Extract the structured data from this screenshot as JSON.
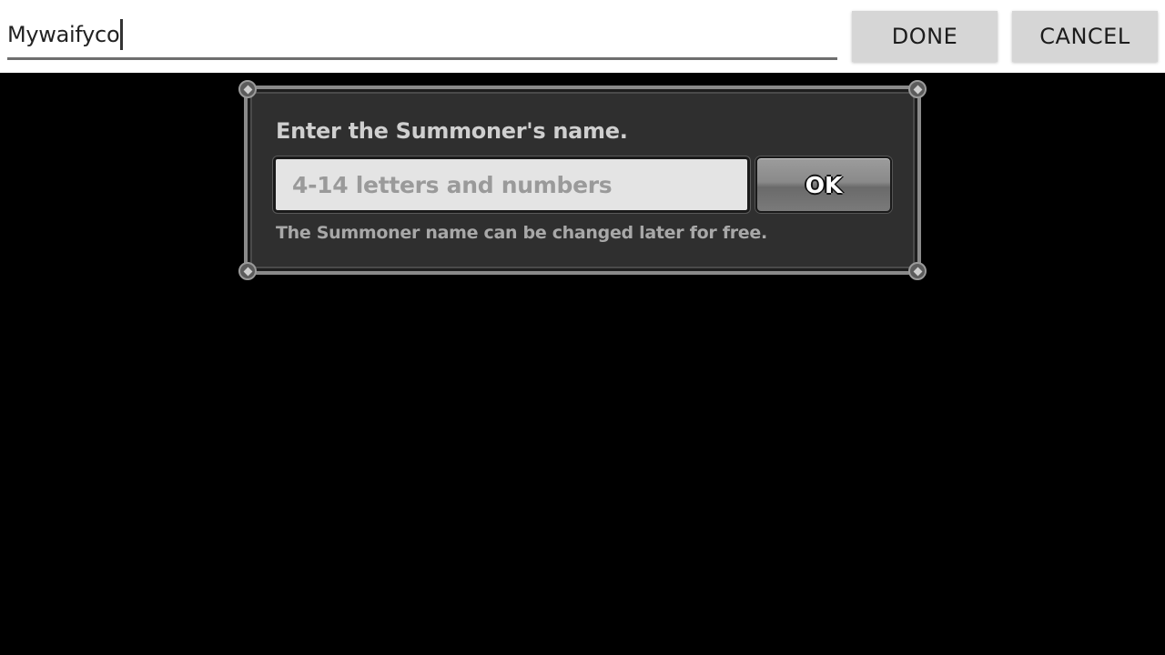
{
  "ime": {
    "input_value": "Mywaifyco",
    "done_label": "DONE",
    "cancel_label": "CANCEL"
  },
  "dialog": {
    "title": "Enter the Summoner's name.",
    "name_placeholder": "4-14 letters and numbers",
    "ok_label": "OK",
    "hint": "The Summoner name can be changed later for free."
  },
  "colors": {
    "background": "#000000",
    "ime_bar": "#ffffff",
    "ime_button": "#d6d6d6",
    "dialog_panel": "#2f2f2f",
    "name_field": "#e4e4e4"
  }
}
